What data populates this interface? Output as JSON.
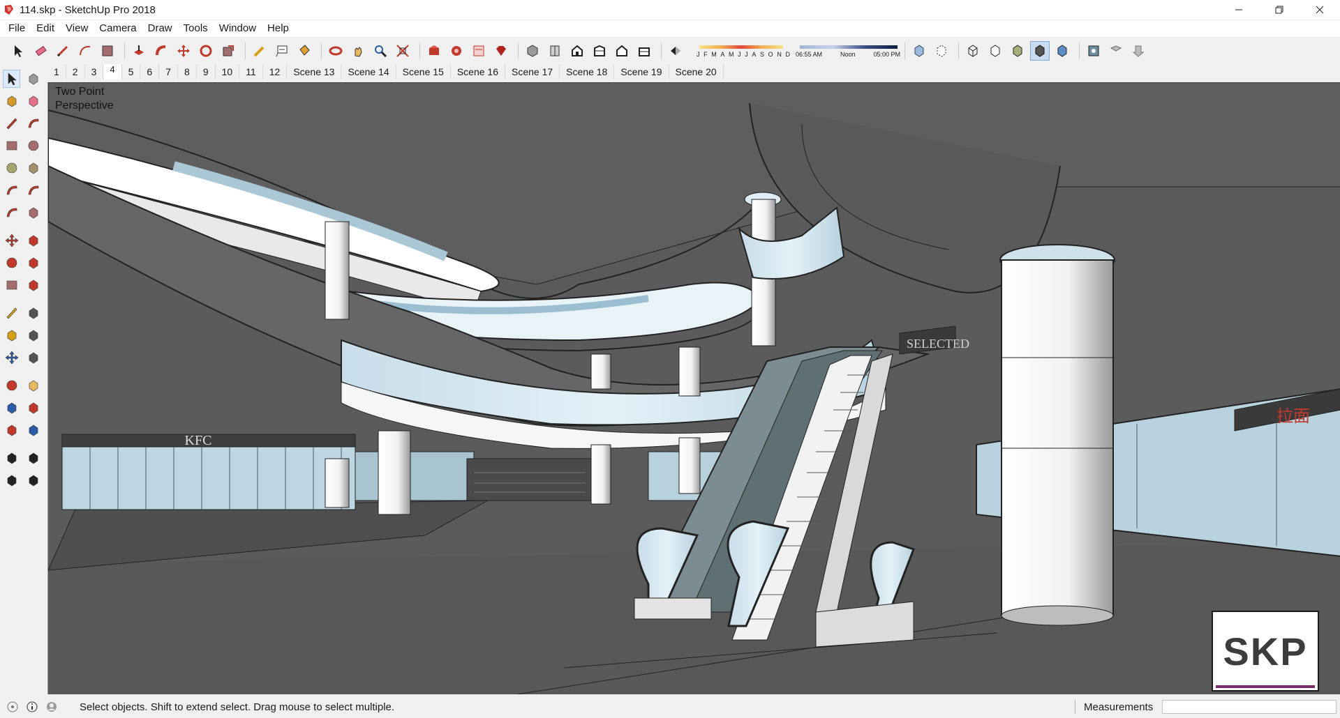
{
  "window": {
    "title": "114.skp - SketchUp Pro 2018",
    "controls": [
      "minimize-icon",
      "restore-icon",
      "close-icon"
    ]
  },
  "menu": [
    "File",
    "Edit",
    "View",
    "Camera",
    "Draw",
    "Tools",
    "Window",
    "Help"
  ],
  "toolbar": {
    "tools": [
      "select-arrow-icon",
      "eraser-icon",
      "pencil-icon",
      "arc-icon",
      "rectangle-icon",
      "push-pull-icon",
      "follow-me-icon",
      "move-icon",
      "rotate-icon",
      "scale-icon",
      "tape-measure-icon",
      "text-icon",
      "paint-bucket-icon",
      "orbit-icon",
      "pan-icon",
      "zoom-icon",
      "zoom-extents-icon",
      "warehouse-icon",
      "extension-warehouse-icon",
      "layout-icon",
      "ruby-gem-icon",
      "iso-view-icon",
      "top-view-icon",
      "front-view-icon",
      "right-view-icon",
      "back-view-icon",
      "left-view-icon",
      "shadows-toggle-icon"
    ],
    "shadow_months": [
      "J",
      "F",
      "M",
      "A",
      "M",
      "J",
      "J",
      "A",
      "S",
      "O",
      "N",
      "D"
    ],
    "shadow_times": [
      "06:55 AM",
      "Noon",
      "05:00 PM"
    ],
    "style_tools": [
      "xray-icon",
      "back-edges-icon",
      "wireframe-icon",
      "hidden-line-icon",
      "shaded-icon",
      "shaded-textures-icon",
      "monochrome-icon",
      "section-plane-icon",
      "section-cut-icon",
      "section-display-icon"
    ]
  },
  "scenes": {
    "tabs": [
      "1",
      "2",
      "3",
      "4",
      "5",
      "6",
      "7",
      "8",
      "9",
      "10",
      "11",
      "12",
      "Scene 13",
      "Scene 14",
      "Scene 15",
      "Scene 16",
      "Scene 17",
      "Scene 18",
      "Scene 19",
      "Scene 20"
    ],
    "active": "4"
  },
  "palette": {
    "rows": [
      [
        "select-arrow-icon",
        "component-icon"
      ],
      [
        "paint-bucket-icon",
        "eraser-icon"
      ],
      [
        "line-icon",
        "freehand-icon"
      ],
      [
        "rectangle-icon",
        "rotated-rectangle-icon"
      ],
      [
        "circle-icon",
        "polygon-icon"
      ],
      [
        "arc-icon",
        "two-point-arc-icon"
      ],
      [
        "three-point-arc-icon",
        "pie-icon"
      ],
      [
        "move-icon",
        "push-pull-icon"
      ],
      [
        "rotate-icon",
        "follow-me-icon"
      ],
      [
        "scale-icon",
        "offset-icon"
      ],
      [
        "tape-measure-icon",
        "dimension-icon"
      ],
      [
        "protractor-icon",
        "text-icon"
      ],
      [
        "axes-icon",
        "3d-text-icon"
      ],
      [
        "orbit-icon",
        "pan-icon"
      ],
      [
        "zoom-icon",
        "zoom-window-icon"
      ],
      [
        "zoom-extents-icon",
        "previous-view-icon"
      ],
      [
        "position-camera-icon",
        "look-around-icon"
      ],
      [
        "walk-icon",
        "section-plane-icon"
      ]
    ]
  },
  "viewport": {
    "label_line1": "Two Point",
    "label_line2": "Perspective",
    "signage_kfc": "KFC",
    "signage_select": "SELECTED",
    "signage_red": "拉面",
    "badge": "SKP"
  },
  "status": {
    "message": "Select objects. Shift to extend select. Drag mouse to select multiple.",
    "measurements_label": "Measurements",
    "measurements_value": ""
  },
  "colors": {
    "viewport_background": "#5b5b5b",
    "glass": "#d5e8f2",
    "column": "#f4f4f4",
    "sign_red": "#c23a30"
  }
}
